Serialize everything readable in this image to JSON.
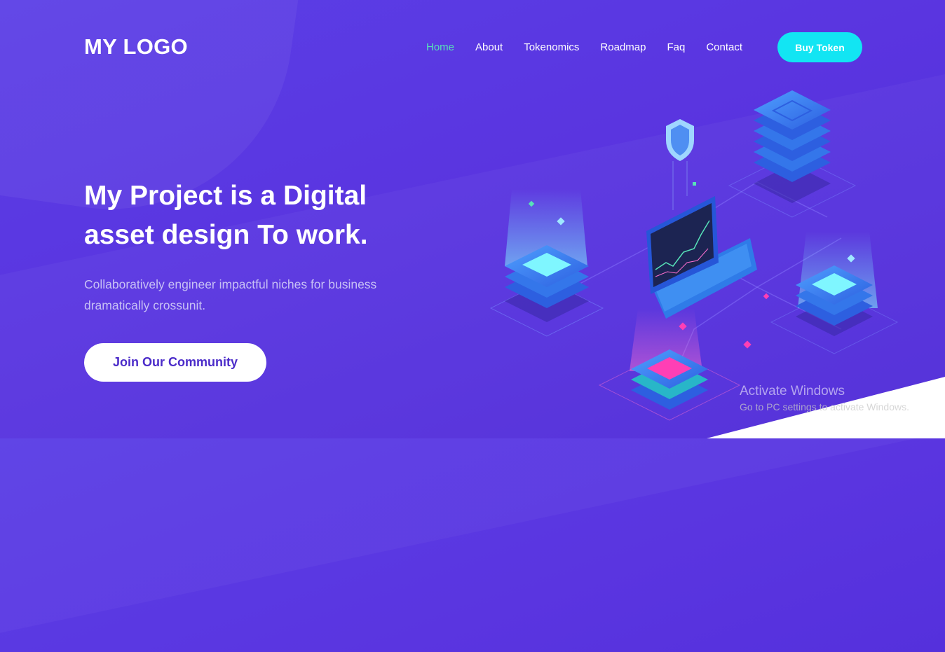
{
  "logo": "MY LOGO",
  "nav": {
    "items": [
      {
        "label": "Home",
        "active": true
      },
      {
        "label": "About",
        "active": false
      },
      {
        "label": "Tokenomics",
        "active": false
      },
      {
        "label": "Roadmap",
        "active": false
      },
      {
        "label": "Faq",
        "active": false
      },
      {
        "label": "Contact",
        "active": false
      }
    ],
    "active_color": "#57e2b8"
  },
  "buy_button": "Buy Token",
  "hero": {
    "title_line1": "My Project is a Digital",
    "title_line2": "asset design To work.",
    "description_line1": "Collaboratively engineer impactful niches for business",
    "description_line2": "dramatically crossunit.",
    "cta": "Join Our Community"
  },
  "watermark": {
    "title": "Activate Windows",
    "subtitle": "Go to PC settings to activate Windows."
  },
  "colors": {
    "background": "#5a35e0",
    "accent_cyan": "#12e5f3",
    "accent_pink": "#ff3fb5"
  },
  "illustration": {
    "icons": [
      "server-stack-icon",
      "laptop-chart-icon",
      "shield-icon"
    ]
  }
}
